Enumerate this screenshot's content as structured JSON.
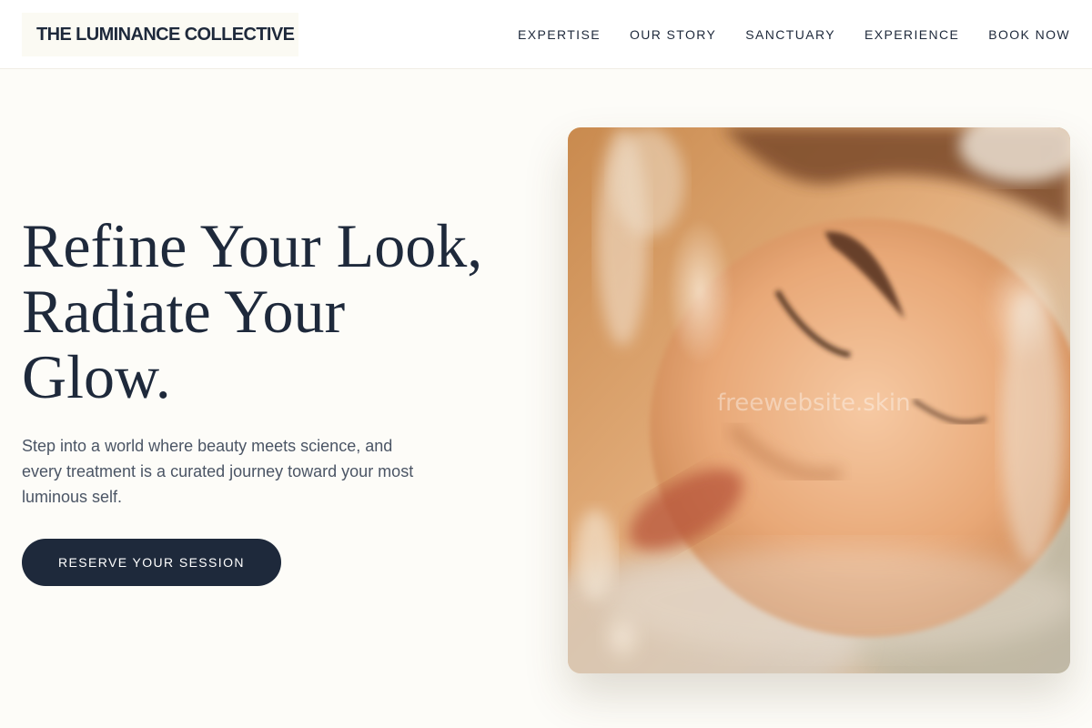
{
  "header": {
    "brand": "THE LUMINANCE COLLECTIVE",
    "nav": [
      {
        "label": "EXPERTISE"
      },
      {
        "label": "OUR STORY"
      },
      {
        "label": "SANCTUARY"
      },
      {
        "label": "EXPERIENCE"
      },
      {
        "label": "BOOK NOW"
      }
    ]
  },
  "hero": {
    "title_lines": [
      "Refine Your Look,",
      "Radiate Your",
      "Glow."
    ],
    "subtitle": "Step into a world where beauty meets science, and every treatment is a curated journey toward your most luminous self.",
    "cta_label": "RESERVE YOUR SESSION",
    "image": {
      "icon": "portrait-photo",
      "watermark": "freewebsite.skin"
    }
  },
  "colors": {
    "page_bg": "#fdfcf8",
    "header_bg": "#ffffff",
    "brand_bg": "#fbfaf3",
    "text_dark": "#1e293b",
    "text_muted": "#4b5565",
    "cta_bg": "#1e293b",
    "cta_text": "#ffffff"
  }
}
